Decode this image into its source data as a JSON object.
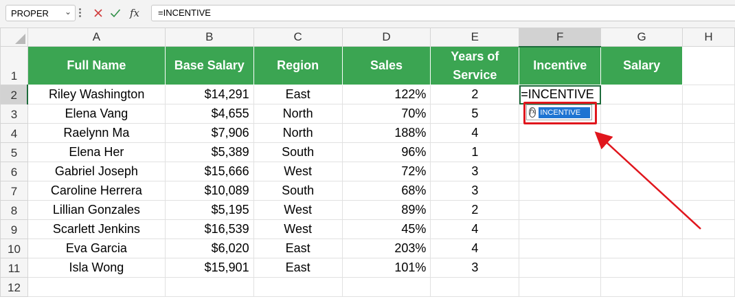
{
  "formula_bar": {
    "name_box": "PROPER",
    "name_box_chevron": "⌄",
    "cancel_icon": "close-icon",
    "enter_icon": "check-icon",
    "fx_label": "fx",
    "formula": "=INCENTIVE"
  },
  "columns": [
    "A",
    "B",
    "C",
    "D",
    "E",
    "F",
    "G",
    "H"
  ],
  "active_column": "F",
  "active_row": "2",
  "header_row": {
    "row_number": "1",
    "cells": [
      "Full Name",
      "Base Salary",
      "Region",
      "Sales",
      "Years of Service",
      "Incentive",
      "Salary"
    ]
  },
  "rows": [
    {
      "row_number": "2",
      "name": "Riley Washington",
      "base_salary": "$14,291",
      "region": "East",
      "sales": "122%",
      "years": "2",
      "incentive": "=INCENTIVE",
      "salary": ""
    },
    {
      "row_number": "3",
      "name": "Elena Vang",
      "base_salary": "$4,655",
      "region": "North",
      "sales": "70%",
      "years": "5",
      "incentive": "",
      "salary": ""
    },
    {
      "row_number": "4",
      "name": "Raelynn Ma",
      "base_salary": "$7,906",
      "region": "North",
      "sales": "188%",
      "years": "4",
      "incentive": "",
      "salary": ""
    },
    {
      "row_number": "5",
      "name": "Elena Her",
      "base_salary": "$5,389",
      "region": "South",
      "sales": "96%",
      "years": "1",
      "incentive": "",
      "salary": ""
    },
    {
      "row_number": "6",
      "name": "Gabriel Joseph",
      "base_salary": "$15,666",
      "region": "West",
      "sales": "72%",
      "years": "3",
      "incentive": "",
      "salary": ""
    },
    {
      "row_number": "7",
      "name": "Caroline Herrera",
      "base_salary": "$10,089",
      "region": "South",
      "sales": "68%",
      "years": "3",
      "incentive": "",
      "salary": ""
    },
    {
      "row_number": "8",
      "name": "Lillian Gonzales",
      "base_salary": "$5,195",
      "region": "West",
      "sales": "89%",
      "years": "2",
      "incentive": "",
      "salary": ""
    },
    {
      "row_number": "9",
      "name": "Scarlett Jenkins",
      "base_salary": "$16,539",
      "region": "West",
      "sales": "45%",
      "years": "4",
      "incentive": "",
      "salary": ""
    },
    {
      "row_number": "10",
      "name": "Eva Garcia",
      "base_salary": "$6,020",
      "region": "East",
      "sales": "203%",
      "years": "4",
      "incentive": "",
      "salary": ""
    },
    {
      "row_number": "11",
      "name": "Isla Wong",
      "base_salary": "$15,901",
      "region": "East",
      "sales": "101%",
      "years": "3",
      "incentive": "",
      "salary": ""
    }
  ],
  "last_row_number": "12",
  "autocomplete": {
    "icon": "function-icon",
    "icon_glyph": "fx",
    "suggestion": "INCENTIVE"
  },
  "colors": {
    "header_fill": "#3ba552",
    "header_text": "#ffffff",
    "active_cell_border": "#1d6b3b",
    "annotation": "#e0161d",
    "suggestion_highlight": "#1e74d2"
  }
}
